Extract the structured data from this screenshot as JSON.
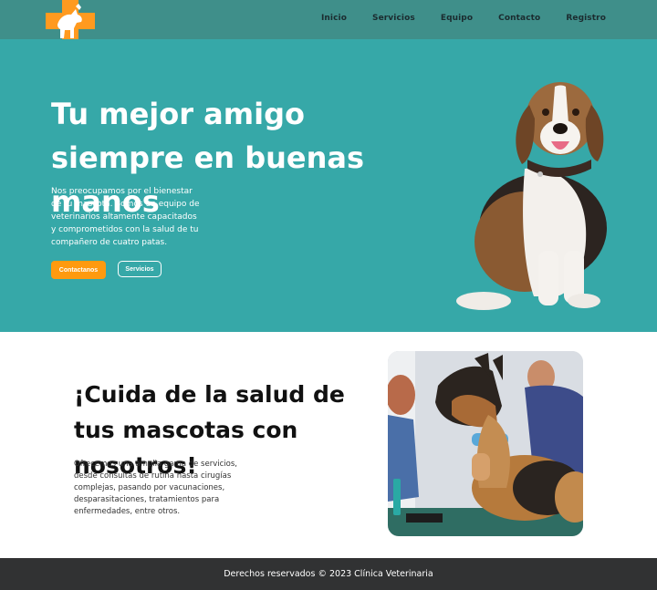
{
  "header": {
    "logo_icon": "pet-cross-logo-icon",
    "nav": [
      "Inicio",
      "Servicios",
      "Equipo",
      "Contacto",
      "Registro"
    ]
  },
  "hero": {
    "title": "Tu mejor amigo siempre en buenas manos",
    "description": "Nos preocupamos por el bienestar de tu mascota. Somos un equipo de veterinarios altamente capacitados y comprometidos con la salud de tu compañero de cuatro patas.",
    "primary_button": "Contactanos",
    "secondary_button": "Servicios",
    "image_icon": "beagle-dog-image"
  },
  "care": {
    "title": "¡Cuida de la salud de tus mascotas con nosotros!",
    "description": "Ofrecemos una amplia gama de servicios, desde consultas de rutina hasta cirugías complejas, pasando por vacunaciones, desparasitaciones, tratamientos para enfermedades, entre otros.",
    "image_icon": "vet-with-german-shepherd-image"
  },
  "footer": {
    "text": "Derechos reservados © 2023 Clínica Veterinaria"
  },
  "colors": {
    "header": "#3f8f8a",
    "hero": "#36a8a8",
    "accent": "#ff9a0f",
    "footer": "#313233"
  }
}
